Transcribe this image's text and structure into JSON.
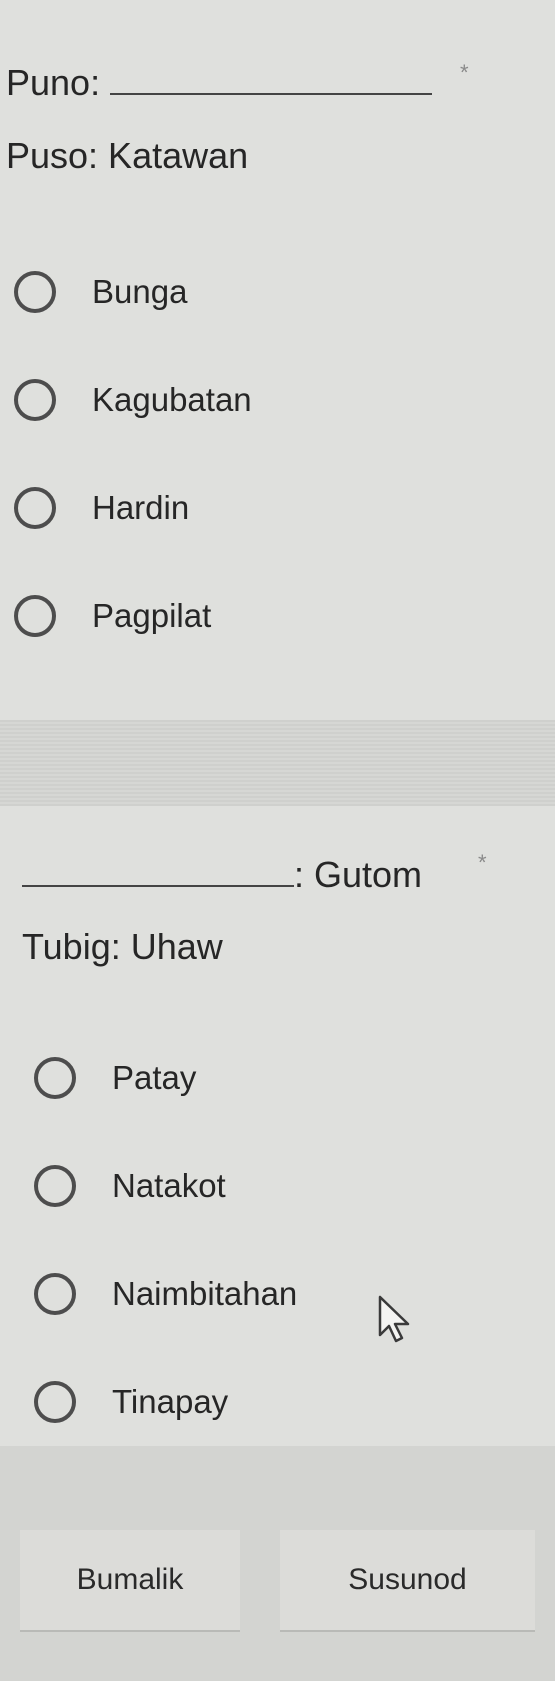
{
  "questions": [
    {
      "title_prefix": "Puno: ",
      "title_suffix": "",
      "required_mark": "*",
      "subtitle": "Puso: Katawan",
      "options": [
        "Bunga",
        "Kagubatan",
        "Hardin",
        "Pagpilat"
      ]
    },
    {
      "title_prefix": "",
      "title_suffix": ": Gutom",
      "required_mark": "*",
      "subtitle": "Tubig: Uhaw",
      "options": [
        "Patay",
        "Natakot",
        "Naimbitahan",
        "Tinapay"
      ]
    }
  ],
  "nav": {
    "back_label": "Bumalik",
    "next_label": "Susunod"
  },
  "icons": {
    "radio": "radio-unchecked-icon",
    "cursor": "mouse-pointer-icon"
  }
}
